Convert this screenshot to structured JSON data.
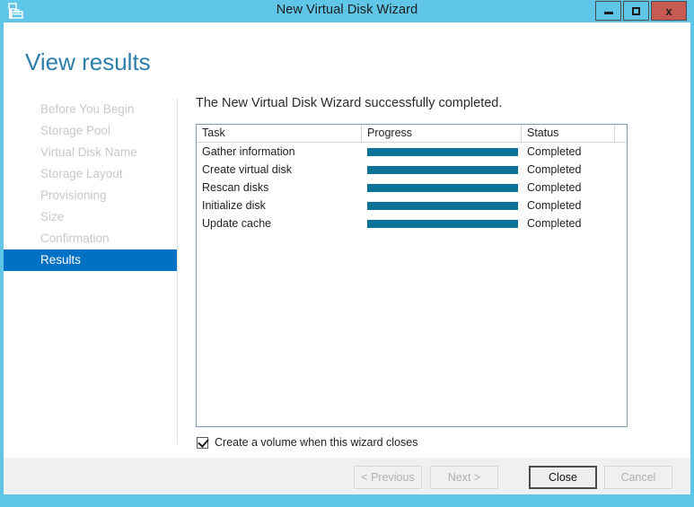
{
  "window": {
    "title": "New Virtual Disk Wizard",
    "icon": "virtual-disk-wizard-icon",
    "titlebar_color": "#5fc6e8",
    "controls": {
      "minimize_label": "",
      "maximize_label": "",
      "close_label": "x"
    }
  },
  "page": {
    "title": "View results",
    "title_color": "#2e7eab"
  },
  "sidebar": {
    "items": [
      {
        "label": "Before You Begin",
        "selected": false
      },
      {
        "label": "Storage Pool",
        "selected": false
      },
      {
        "label": "Virtual Disk Name",
        "selected": false
      },
      {
        "label": "Storage Layout",
        "selected": false
      },
      {
        "label": "Provisioning",
        "selected": false
      },
      {
        "label": "Size",
        "selected": false
      },
      {
        "label": "Confirmation",
        "selected": false
      },
      {
        "label": "Results",
        "selected": true
      }
    ],
    "selected_color": "#0072c6"
  },
  "main": {
    "heading": "The New Virtual Disk Wizard successfully completed.",
    "table": {
      "columns": [
        "Task",
        "Progress",
        "Status"
      ],
      "progress_color": "#0a7396",
      "rows": [
        {
          "task": "Gather information",
          "progress": 100,
          "status": "Completed"
        },
        {
          "task": "Create virtual disk",
          "progress": 100,
          "status": "Completed"
        },
        {
          "task": "Rescan disks",
          "progress": 100,
          "status": "Completed"
        },
        {
          "task": "Initialize disk",
          "progress": 100,
          "status": "Completed"
        },
        {
          "task": "Update cache",
          "progress": 100,
          "status": "Completed"
        }
      ]
    },
    "checkbox": {
      "label": "Create a volume when this wizard closes",
      "checked": true
    }
  },
  "footer": {
    "previous_label": "< Previous",
    "next_label": "Next >",
    "close_label": "Close",
    "cancel_label": "Cancel"
  }
}
